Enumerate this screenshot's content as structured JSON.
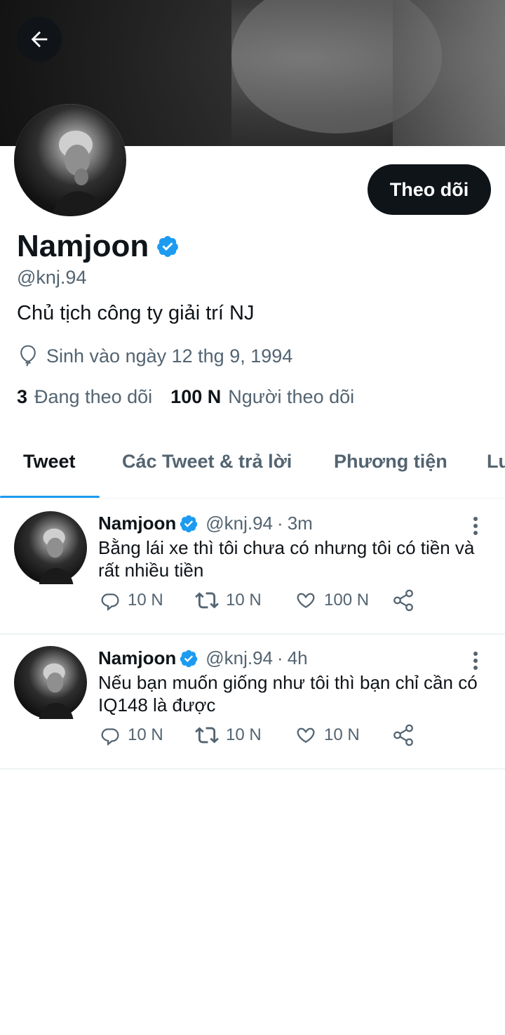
{
  "profile": {
    "display_name": "Namjoon",
    "handle": "@knj.94",
    "bio": "Chủ tịch công ty giải trí NJ",
    "birth_text": "Sinh vào ngày 12 thg 9, 1994",
    "follow_label": "Theo dõi",
    "following_count": "3",
    "following_label": "Đang theo dõi",
    "followers_count": "100 N",
    "followers_label": "Người theo dõi"
  },
  "tabs": [
    {
      "label": "Tweet",
      "active": true
    },
    {
      "label": "Các Tweet & trả lời",
      "active": false
    },
    {
      "label": "Phương tiện",
      "active": false
    },
    {
      "label": "Lu",
      "active": false
    }
  ],
  "tweets": [
    {
      "name": "Namjoon",
      "handle": "@knj.94",
      "dot": "·",
      "time": "3m",
      "text": "Bằng lái xe thì tôi chưa có nhưng tôi có tiền và rất nhiều tiền",
      "replies": "10 N",
      "retweets": "10 N",
      "likes": "100 N"
    },
    {
      "name": "Namjoon",
      "handle": "@knj.94",
      "dot": "·",
      "time": "4h",
      "text": "Nếu bạn muốn giống như tôi thì bạn chỉ cần có IQ148 là được",
      "replies": "10 N",
      "retweets": "10 N",
      "likes": "10 N"
    }
  ],
  "colors": {
    "accent": "#1d9bf0",
    "text": "#0f1419",
    "secondary": "#536471"
  },
  "icons": {
    "back": "arrow-left-icon",
    "verified": "verified-badge-icon",
    "birth": "balloon-icon",
    "reply": "reply-icon",
    "retweet": "retweet-icon",
    "like": "heart-icon",
    "share": "share-icon",
    "more": "more-vertical-icon"
  }
}
